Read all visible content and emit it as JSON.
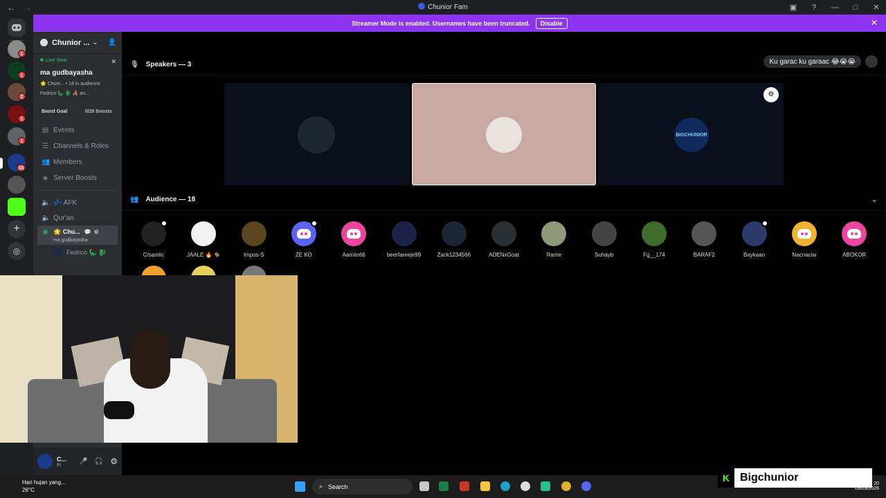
{
  "window": {
    "title": "Chunior Fam"
  },
  "banner": {
    "text": "Streamer Mode is enabled. Usernames have been truncated.",
    "disable_label": "Disable"
  },
  "servers": {
    "badges": [
      "1",
      "1",
      "3",
      "1",
      "1",
      "15"
    ]
  },
  "server_header": {
    "name": "Chunior ..."
  },
  "live": {
    "label": "Live Now",
    "stream_title": "ma gudbayasha",
    "channel": "🌟 Chuni...",
    "audience": "18 in audience",
    "participants": "Fedrico 🦕 🐉 🦂 an..."
  },
  "boost": {
    "label": "Boost Goal",
    "value": "0/28 Boosts"
  },
  "menu": [
    "Events",
    "Channels & Roles",
    "Members",
    "Server Boosts"
  ],
  "channels": {
    "afk": "💤 AFK",
    "quran": "Qur'an",
    "active_name": "🌟 Chu...",
    "active_sub": "ma gudbayasha",
    "active_user": "Fedrico 🦕 🐉"
  },
  "user_panel": {
    "name": "C...",
    "status": "In"
  },
  "speakers": {
    "heading": "Speakers — 3",
    "tile3_text": "BIGCHUNIOR"
  },
  "chat_bubble": "Ku garac ku garaac 😂😭😭",
  "audience": {
    "heading": "Audience — 18",
    "members": [
      {
        "name": "C/samiic",
        "color": "#222222",
        "muted": true
      },
      {
        "name": "JAALE 🔥 🐐",
        "color": "#f2f2f2",
        "muted": false
      },
      {
        "name": "Impos-S",
        "color": "#5a4520",
        "muted": false
      },
      {
        "name": "ZE KO",
        "color": "#5865f2",
        "muted": true,
        "discord": true,
        "dcolor": "#5865f2"
      },
      {
        "name": "Aamiin66",
        "color": "#eb459e",
        "muted": false,
        "discord": true,
        "dcolor": "#eb459e"
      },
      {
        "name": "beerfareeje99",
        "color": "#1d2247",
        "muted": false
      },
      {
        "name": "Zack1234566",
        "color": "#1c2535",
        "muted": false
      },
      {
        "name": "ADENxGoat",
        "color": "#2a2f33",
        "muted": false
      },
      {
        "name": "Rame",
        "color": "#8c9a7a",
        "muted": false
      },
      {
        "name": "Suhayb",
        "color": "#444444",
        "muted": false
      },
      {
        "name": "Fg__174",
        "color": "#3c6b2a",
        "muted": false
      },
      {
        "name": "BARAF2",
        "color": "#555555",
        "muted": false
      },
      {
        "name": "Baykaan",
        "color": "#2b3a68",
        "muted": true
      },
      {
        "name": "Nacnaciw",
        "color": "#f0b232",
        "muted": false,
        "discord": true,
        "dcolor": "#f0b232"
      },
      {
        "name": "ABOKOR",
        "color": "#eb459e",
        "muted": false,
        "discord": true,
        "dcolor": "#eb459e"
      }
    ]
  },
  "taskbar": {
    "weather_text": "Hari hujan yang...",
    "weather_temp": "26°C",
    "search_label": "Search",
    "date": "03/03/2026",
    "time": "20"
  },
  "brand": {
    "name": "Bigchunior"
  },
  "colors": {
    "accent": "#8c34f2",
    "live": "#23a55a",
    "badge": "#f23f43",
    "brand_green": "#53fc18"
  }
}
